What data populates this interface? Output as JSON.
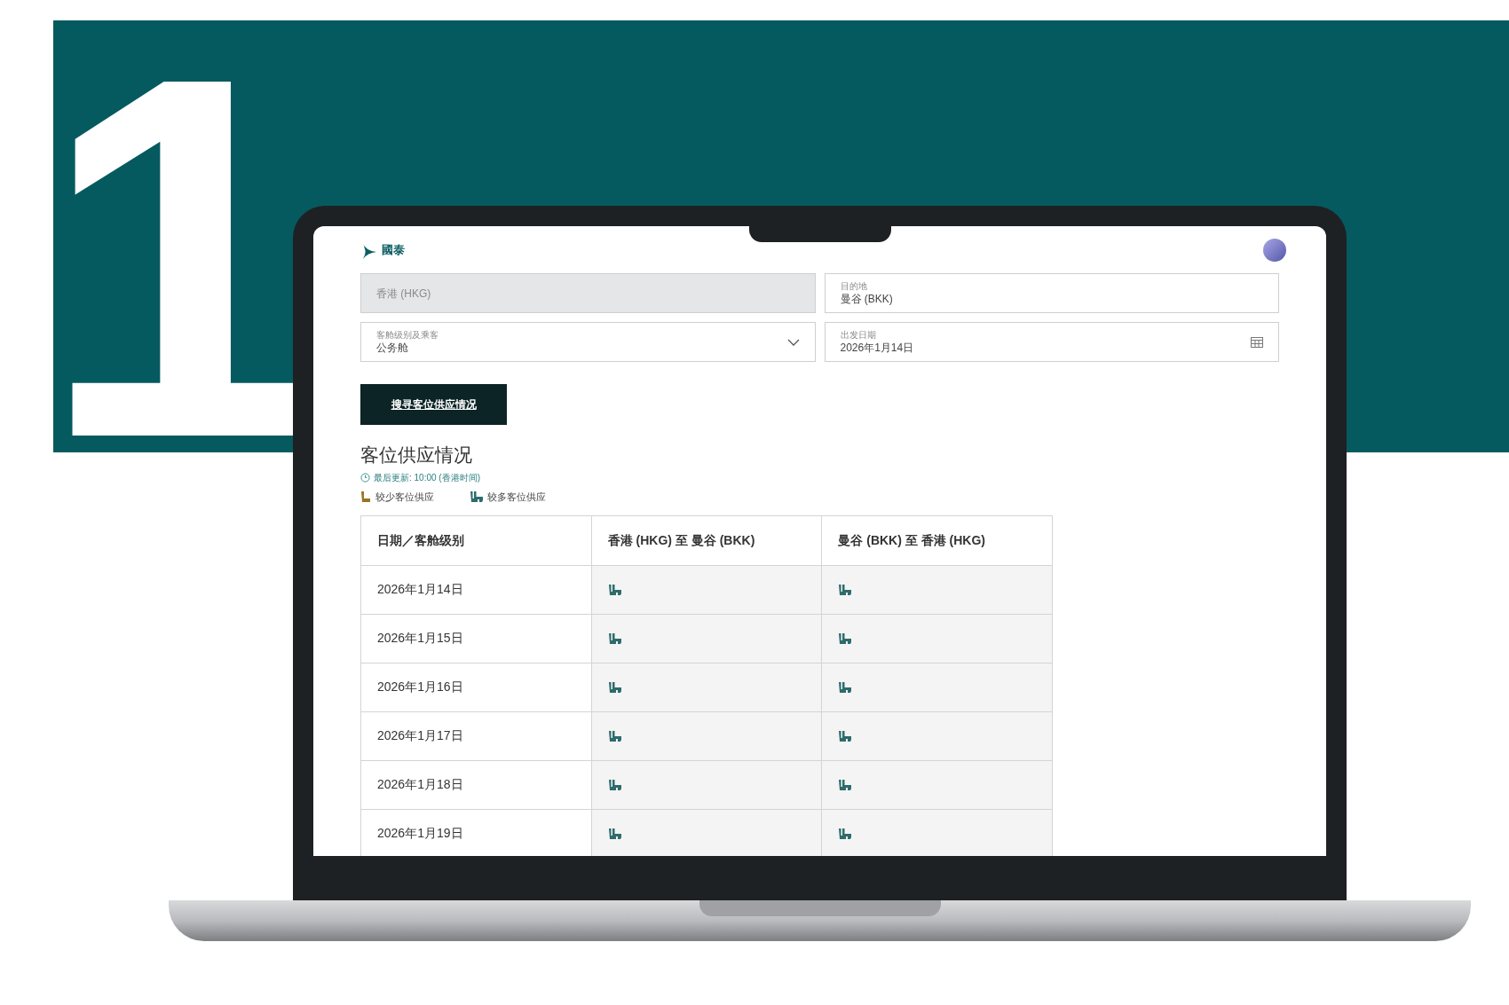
{
  "step_number": "1",
  "brand": {
    "name": "國泰"
  },
  "form": {
    "origin": {
      "value": "香港 (HKG)",
      "disabled": true
    },
    "destination": {
      "label": "目的地",
      "value": "曼谷 (BKK)"
    },
    "cabin": {
      "label": "客舱级别及乘客",
      "value": "公务舱"
    },
    "date": {
      "label": "出发日期",
      "value": "2026年1月14日"
    },
    "search_button": "搜寻客位供应情况"
  },
  "results": {
    "title": "客位供应情况",
    "updated": "最后更新: 10:00 (香港时间)",
    "legend": [
      {
        "kind": "few",
        "label": "较少客位供应"
      },
      {
        "kind": "more",
        "label": "较多客位供应"
      }
    ]
  },
  "table": {
    "columns": [
      "日期／客舱级别",
      "香港 (HKG) 至 曼谷 (BKK)",
      "曼谷 (BKK) 至 香港 (HKG)"
    ],
    "rows": [
      {
        "date": "2026年1月14日",
        "outbound": {
          "kind": "more"
        },
        "inbound": {
          "kind": "more"
        }
      },
      {
        "date": "2026年1月15日",
        "outbound": {
          "kind": "more"
        },
        "inbound": {
          "kind": "more"
        }
      },
      {
        "date": "2026年1月16日",
        "outbound": {
          "kind": "more"
        },
        "inbound": {
          "kind": "more"
        }
      },
      {
        "date": "2026年1月17日",
        "outbound": {
          "kind": "more"
        },
        "inbound": {
          "kind": "more"
        }
      },
      {
        "date": "2026年1月18日",
        "outbound": {
          "kind": "more"
        },
        "inbound": {
          "kind": "more"
        }
      },
      {
        "date": "2026年1月19日",
        "outbound": {
          "kind": "more"
        },
        "inbound": {
          "kind": "more"
        }
      }
    ]
  }
}
